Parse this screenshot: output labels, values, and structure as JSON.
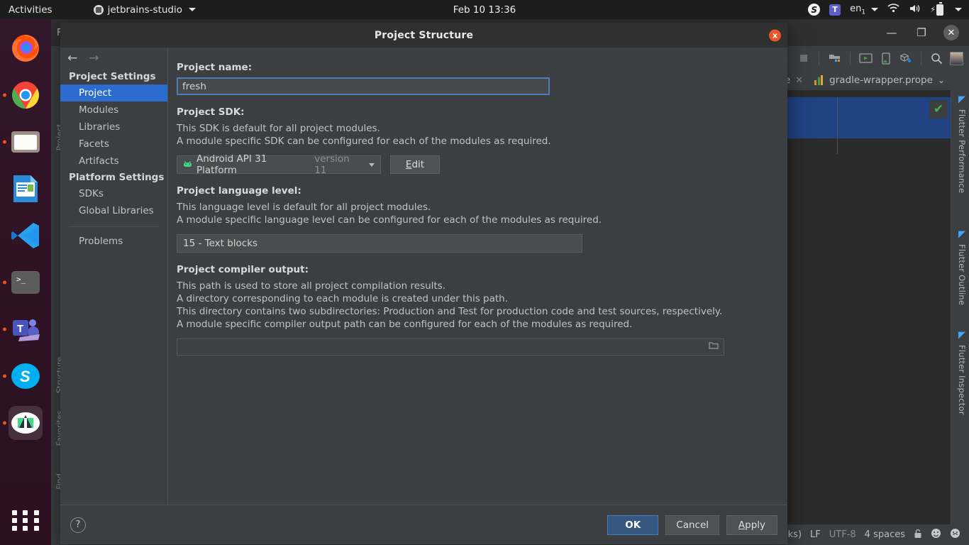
{
  "gnome_panel": {
    "activities": "Activities",
    "app_name": "jetbrains-studio",
    "clock": "Feb 10  13:36",
    "skype_icon": "skype-icon",
    "teams_icon": "teams-icon",
    "language": "en",
    "language_sub": "1",
    "wifi_icon": "wifi-icon",
    "volume_icon": "volume-icon",
    "battery_icon": "battery-charging-icon",
    "system_caret": "chevron-down-icon"
  },
  "dock": {
    "items": [
      {
        "name": "firefox",
        "label": "Firefox",
        "running": false
      },
      {
        "name": "chrome",
        "label": "Google Chrome",
        "running": true
      },
      {
        "name": "files",
        "label": "Files",
        "running": true
      },
      {
        "name": "libreoffice",
        "label": "LibreOffice Writer",
        "running": false
      },
      {
        "name": "vscode",
        "label": "Visual Studio Code",
        "running": false
      },
      {
        "name": "terminal",
        "label": "Terminal",
        "running": true
      },
      {
        "name": "teams",
        "label": "Microsoft Teams",
        "running": true
      },
      {
        "name": "skype",
        "label": "Skype",
        "running": true
      },
      {
        "name": "android-studio",
        "label": "Android Studio",
        "running": true,
        "active": true
      }
    ],
    "show_apps_label": "Show Applications"
  },
  "ide": {
    "menu_hint": "F",
    "window_controls": {
      "minimize": "—",
      "maximize": "❐",
      "close": "✕"
    },
    "toolbar_icons": [
      "device-icon",
      "flutter-run-icon",
      "stop-icon",
      "project-structure-icon",
      "avd-manager-icon",
      "sdk-device-icon",
      "sdk-manager-icon",
      "search-icon",
      "avatar"
    ],
    "tabs": [
      {
        "label": "le",
        "close": "✕"
      },
      {
        "label": "gradle-wrapper.prope",
        "icon": "gradle-file-icon",
        "chevron": "⌄"
      }
    ],
    "left_stripe": [
      "Project",
      "Structure",
      "Favorites",
      "Find"
    ],
    "right_stripe": [
      "Flutter Performance",
      "Flutter Outline",
      "Flutter Inspector"
    ],
    "editor_badge": "✔",
    "status_bar": {
      "line_sep_partial": "aks)",
      "line_ending": "LF",
      "encoding": "UTF-8",
      "indent": "4 spaces",
      "lock_icon": "lock-icon",
      "happy_icon": "happy-face-icon",
      "sad_icon": "sad-face-icon"
    }
  },
  "dialog": {
    "title": "Project Structure",
    "close_label": "x",
    "nav": {
      "back": "←",
      "forward": "→"
    },
    "sidebar": [
      {
        "type": "group",
        "label": "Project Settings"
      },
      {
        "type": "item",
        "label": "Project",
        "selected": true
      },
      {
        "type": "item",
        "label": "Modules",
        "selected": false
      },
      {
        "type": "item",
        "label": "Libraries",
        "selected": false
      },
      {
        "type": "item",
        "label": "Facets",
        "selected": false
      },
      {
        "type": "item",
        "label": "Artifacts",
        "selected": false
      },
      {
        "type": "group",
        "label": "Platform Settings"
      },
      {
        "type": "item",
        "label": "SDKs",
        "selected": false
      },
      {
        "type": "item",
        "label": "Global Libraries",
        "selected": false
      },
      {
        "type": "sep"
      },
      {
        "type": "item",
        "label": "Problems",
        "selected": false
      }
    ],
    "project_name": {
      "label": "Project name:",
      "value": "fresh",
      "placeholder": ""
    },
    "project_sdk": {
      "label": "Project SDK:",
      "desc_line1": "This SDK is default for all project modules.",
      "desc_line2": "A module specific SDK can be configured for each of the modules as required.",
      "selected": "Android API 31 Platform",
      "selected_suffix": "version 11",
      "sdk_icon": "android-icon",
      "edit_button": {
        "prefix": "",
        "accel": "E",
        "rest": "dit"
      }
    },
    "language_level": {
      "label": "Project language level:",
      "desc_line1": "This language level is default for all project modules.",
      "desc_line2": "A module specific language level can be configured for each of the modules as required.",
      "selected": "15 - Text blocks"
    },
    "compiler_output": {
      "label": "Project compiler output:",
      "desc_line1": "This path is used to store all project compilation results.",
      "desc_line2": "A directory corresponding to each module is created under this path.",
      "desc_line3": "This directory contains two subdirectories: Production and Test for production code and test sources, respectively.",
      "desc_line4": "A module specific compiler output path can be configured for each of the modules as required.",
      "value": "",
      "browse_icon": "folder-icon"
    },
    "footer": {
      "help": "?",
      "ok": "OK",
      "cancel": "Cancel",
      "apply_accel": "A",
      "apply_rest": "pply"
    }
  },
  "colors": {
    "accent_blue": "#2d6ccf",
    "primary_button": "#365880",
    "dialog_bg": "#3c3f41",
    "panel_bg": "#1d1d1d",
    "close_red": "#e9562a",
    "android_green": "#3ddc84",
    "selection_blue": "#214283"
  }
}
